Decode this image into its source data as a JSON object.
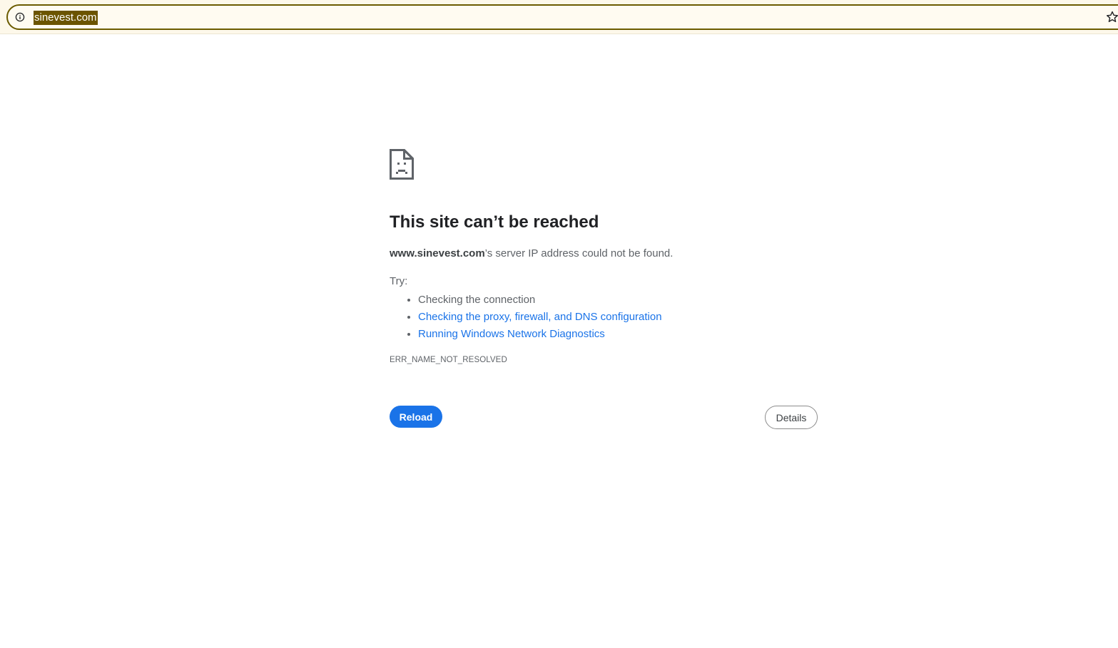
{
  "browser": {
    "address_bar": {
      "url": "sinevest.com",
      "info_icon": "info-circle-icon",
      "bookmark_icon": "star-icon"
    }
  },
  "error_page": {
    "icon": "sad-page-icon",
    "title": "This site can’t be reached",
    "summary_host": "www.sinevest.com",
    "summary_text": "’s server IP address could not be found.",
    "try_label": "Try:",
    "suggestions": [
      {
        "text": "Checking the connection",
        "is_link": false
      },
      {
        "text": "Checking the proxy, firewall, and DNS configuration",
        "is_link": true
      },
      {
        "text": "Running Windows Network Diagnostics",
        "is_link": true
      }
    ],
    "error_code": "ERR_NAME_NOT_RESOLVED",
    "reload_label": "Reload",
    "details_label": "Details"
  },
  "colors": {
    "link": "#1a73e8",
    "primary_button": "#1a73e8",
    "address_bar_border": "#6b5b00",
    "url_selection": "#6b5400"
  }
}
